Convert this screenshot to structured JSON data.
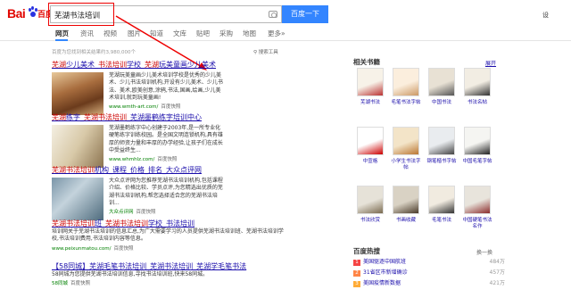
{
  "logo": {
    "bai": "Bai",
    "du": "百度"
  },
  "search": {
    "query": "芜湖书法培训",
    "button": "百度一下"
  },
  "top_right": "设",
  "tabs": [
    "网页",
    "资讯",
    "视频",
    "图片",
    "知道",
    "文库",
    "贴吧",
    "采购",
    "地图",
    "更多»"
  ],
  "result_count": "百度为您找到相关结果约3,980,000个",
  "search_tools": "搜索工具",
  "results": [
    {
      "title_red": "芜湖",
      "title_main": "少儿美术_",
      "title_red2": "书法培训",
      "title_main2": "学校_",
      "title_red3": "芜湖",
      "title_main3": "玩美童画少儿美术",
      "desc": "芜湖玩美童画少儿美术培训学校是优秀的少儿美术、少儿书法培训机构,开设有少儿美术、少儿书法、美术,欧美创意,涂鸦,书法,国画,绘画,少儿美术培训,就到玩美童画!",
      "url": "www.wmth-art.com/",
      "snap": "百度快照"
    },
    {
      "title_red": "芜湖",
      "title_main": "练字_",
      "title_red2": "芜湖书法培训",
      "title_main2": "_芜湖墨鹤练字培训中心",
      "desc": "芜湖墨鹤练字中心创建于2003年,是一所专业化硬笔练字训练校园。是全国文明连锁机构,具有雄厚的师资力量和丰厚的办学经验,让孩子们在成长中受益终生...",
      "url": "www.whmhlz.com/",
      "snap": "百度快照"
    },
    {
      "title_red": "芜湖书法培训",
      "title_main": "机构_课程_价格_排名_大众点评网",
      "desc": "大众点评网为您推荐芜湖书法培训机构,包括课程介绍、价格比较、学员点评,为您精选出优质的芜湖书法培训机构,帮您选择适合您的芜湖书法培训...",
      "url": "大众点评网",
      "snap": "百度快照"
    },
    {
      "title_red": "芜湖书法培训",
      "title_main": "班_",
      "title_red2": "芜湖书法培训",
      "title_main2": "学校_书法培训",
      "desc": "培训网关于芜湖书法培训的信息汇总,为广大需要学习的人员提供芜湖书法培训班、芜湖书法培训学校,书法培训费用,书法培训内容等信息。",
      "url": "www.peixunmatou.com/",
      "snap": "百度快照"
    },
    {
      "title_main": "【58同城】芜湖毛笔书法培训_芜湖书法培训_芜湖学毛笔书法",
      "desc": "58同城为您提供芜湖书法培训信息,寻找书法培训班,快来58同城。",
      "url": "58同城",
      "snap": "百度快照"
    }
  ],
  "related_books": {
    "heading": "相关书籍",
    "more": "展开",
    "row1": [
      "芜湖书法",
      "毛笔书法字帖",
      "中国书法",
      "书法名帖"
    ],
    "row2": [
      "中宣格",
      "小学生书法字帖",
      "钢笔楷书字帖",
      "中国毛笔字帖"
    ],
    "row3": [
      "书法欣赏",
      "书画收藏",
      "毛笔书法",
      "中国硬笔书法名作"
    ]
  },
  "hot": {
    "heading": "百度热搜",
    "refresh": "换一换",
    "items": [
      {
        "rank": "1",
        "text": "美国驱逐中国航班",
        "count": "484万"
      },
      {
        "rank": "2",
        "text": "31省区市新增确诊",
        "count": "457万"
      },
      {
        "rank": "3",
        "text": "美国疫情新数据",
        "count": "421万"
      }
    ]
  }
}
